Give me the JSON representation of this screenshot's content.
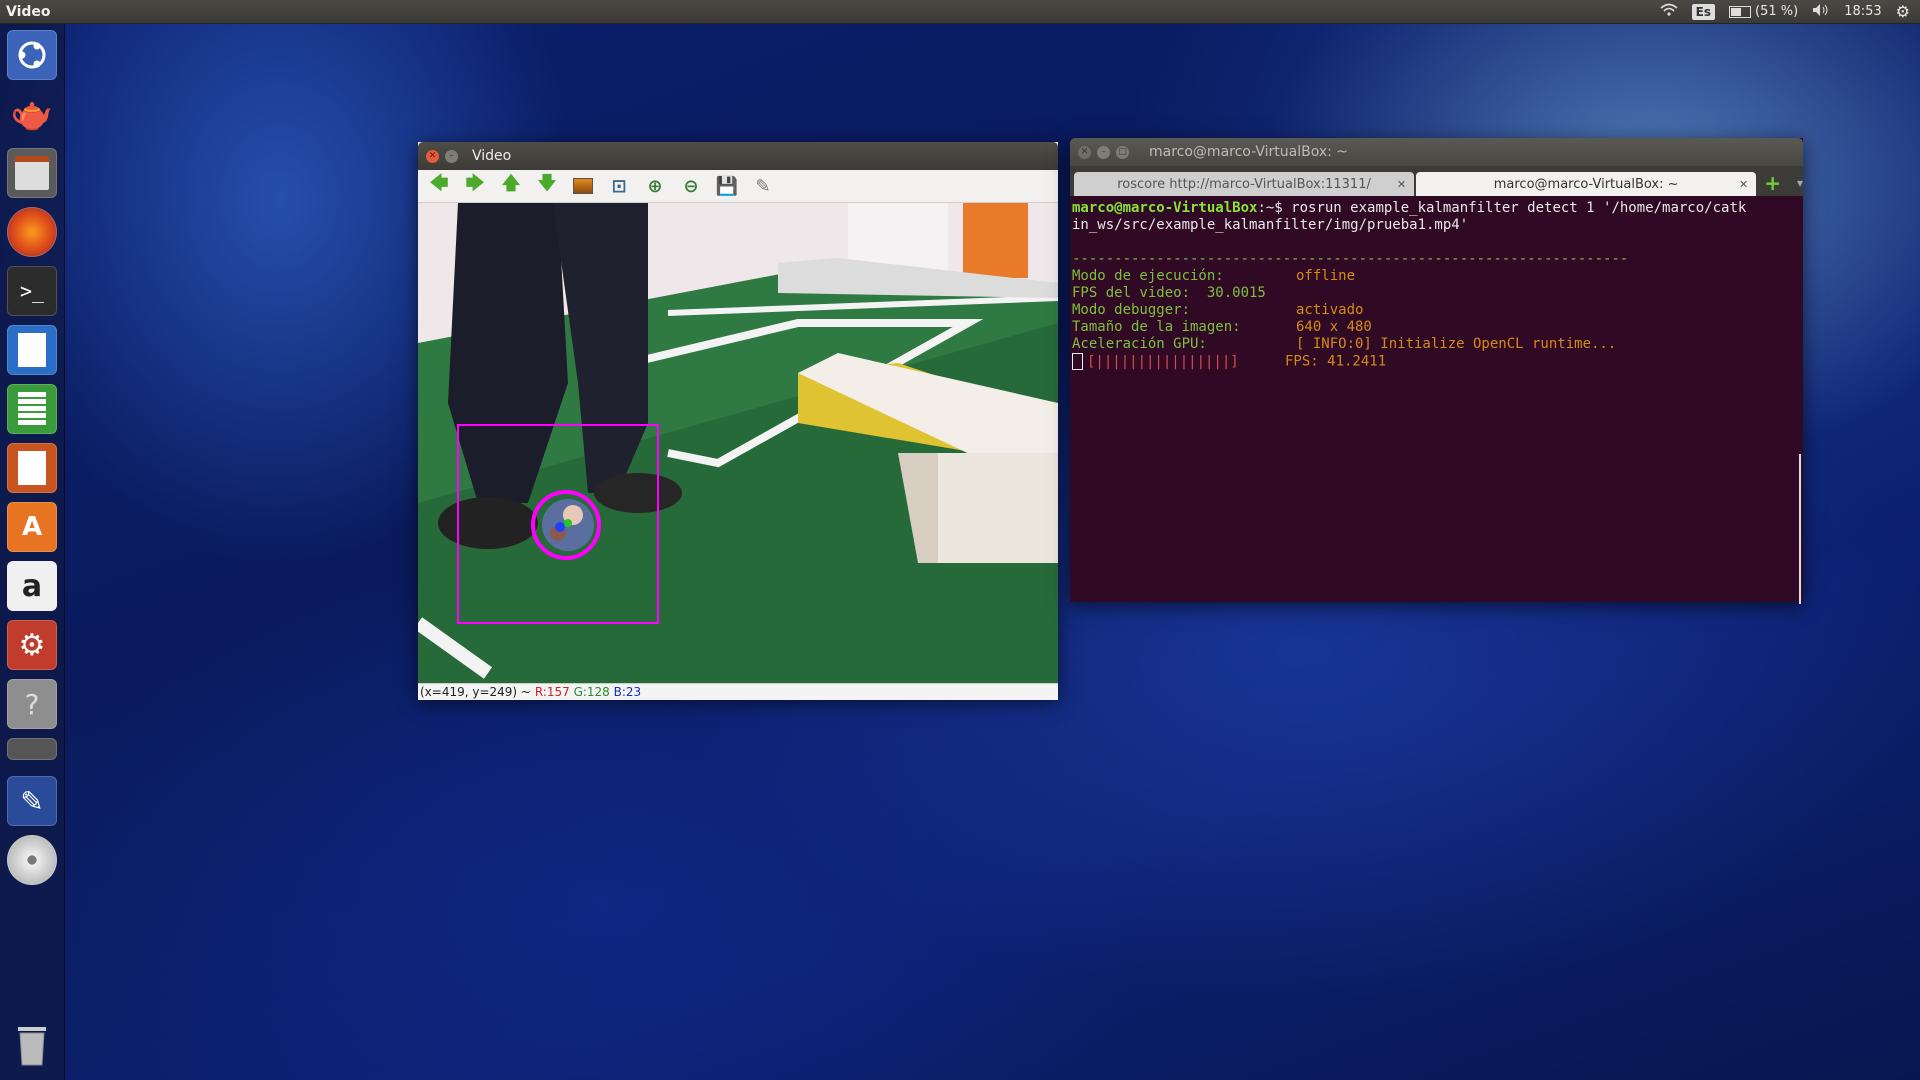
{
  "top_panel": {
    "app_title": "Video",
    "keyboard_layout": "Es",
    "battery": "(51 %)",
    "clock": "18:53"
  },
  "launcher": {
    "items": [
      "ubuntu-dash-icon",
      "teapot-icon",
      "files-icon",
      "firefox-icon",
      "terminal-icon",
      "writer-icon",
      "calc-icon",
      "impress-icon",
      "software-center-icon",
      "amazon-icon",
      "system-settings-icon",
      "help-icon",
      "drive-icon",
      "text-editor-icon",
      "disc-icon",
      "trash-icon"
    ]
  },
  "video_window": {
    "title": "Video",
    "toolbar": [
      "arrow-left-icon",
      "arrow-right-icon",
      "arrow-up-icon",
      "arrow-down-icon",
      "image-icon",
      "zoom-fit-icon",
      "zoom-in-icon",
      "zoom-out-icon",
      "save-icon",
      "properties-icon"
    ],
    "status": {
      "coords": "(x=419, y=249) ~",
      "r": "R:157",
      "g": "G:128",
      "b": "B:23"
    }
  },
  "terminal_window": {
    "title": "marco@marco-VirtualBox: ~",
    "tabs": [
      {
        "label": "roscore http://marco-VirtualBox:11311/",
        "active": false
      },
      {
        "label": "marco@marco-VirtualBox: ~",
        "active": true
      }
    ],
    "prompt": "marco@marco-VirtualBox",
    "command": ":~$ rosrun example_kalmanfilter detect 1 '/home/marco/catk",
    "command_cont": "in_ws/src/example_kalmanfilter/img/prueba1.mp4'",
    "separator": "------------------------------------------------------------------",
    "rows": [
      {
        "label": "Modo de ejecución:",
        "value": "offline"
      },
      {
        "label": "FPS del video:  30.0015",
        "value": ""
      },
      {
        "label": "Modo debugger:",
        "value": "activado"
      },
      {
        "label": "Tamaño de la imagen:",
        "value": "640 x 480"
      },
      {
        "label": "Aceleración GPU:",
        "value": "[ INFO:0] Initialize OpenCL runtime..."
      }
    ],
    "progress_bar": "[||||||||||||||||]",
    "fps": "FPS: 41.2411"
  },
  "colors": {
    "terminal_bg": "#300a24",
    "detection_box": "#ff00ff",
    "prompt_green": "#8ae234",
    "status_r": "#d42020",
    "status_g": "#2a8a2a",
    "status_b": "#1030c0"
  }
}
